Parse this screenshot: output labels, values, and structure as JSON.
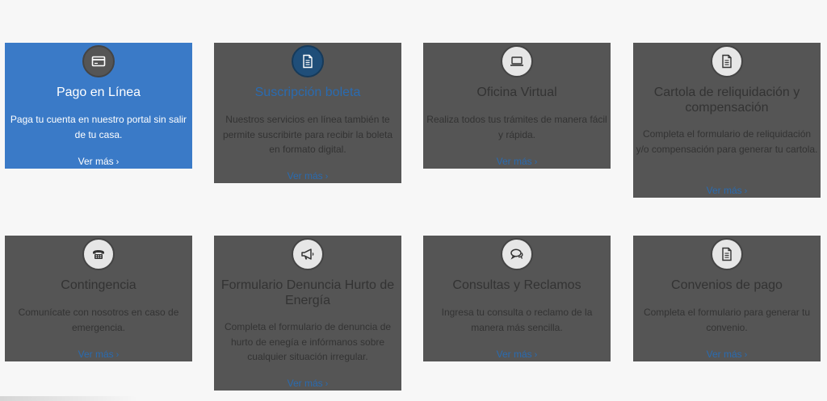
{
  "colors": {
    "card_bg": "#555555",
    "card_active_bg": "#3a7ac7",
    "link_blue": "#2a6bb0",
    "highlight_icon_bg": "#1f4e79",
    "page_bg": "#f7f7f7"
  },
  "cards": [
    {
      "icon": "credit-card-icon",
      "title": "Pago en Línea",
      "description": "Paga tu cuenta en nuestro portal sin salir de tu casa.",
      "more": "Ver más",
      "active": true
    },
    {
      "icon": "document-icon",
      "title": "Suscripción boleta",
      "description": "Nuestros servicios en línea también te permite suscribirte para recibir la boleta en formato digital.",
      "more": "Ver más",
      "title_highlighted": true
    },
    {
      "icon": "laptop-icon",
      "title": "Oficina Virtual",
      "description": "Realiza todos tus trámites de manera fácil y rápida.",
      "more": "Ver más"
    },
    {
      "icon": "document-icon",
      "title": "Cartola de reliquidación y compensación",
      "description": "Completa el formulario de reliquidación y/o compensación para generar tu cartola.",
      "more": "Ver más"
    },
    {
      "icon": "telephone-icon",
      "title": "Contingencia",
      "description": "Comunícate con nosotros en caso de emergencia.",
      "more": "Ver más"
    },
    {
      "icon": "megaphone-icon",
      "title": "Formulario Denuncia Hurto de Energía",
      "description": "Completa el formulario de denuncia de hurto de enegía e infórmanos sobre cualquier situación irregular.",
      "more": "Ver más"
    },
    {
      "icon": "chat-bubbles-icon",
      "title": "Consultas y Reclamos",
      "description": "Ingresa tu consulta o reclamo de la manera más sencilla.",
      "more": "Ver más"
    },
    {
      "icon": "document-icon",
      "title": "Convenios de pago",
      "description": "Completa el formulario para generar tu convenio.",
      "more": "Ver más"
    }
  ]
}
